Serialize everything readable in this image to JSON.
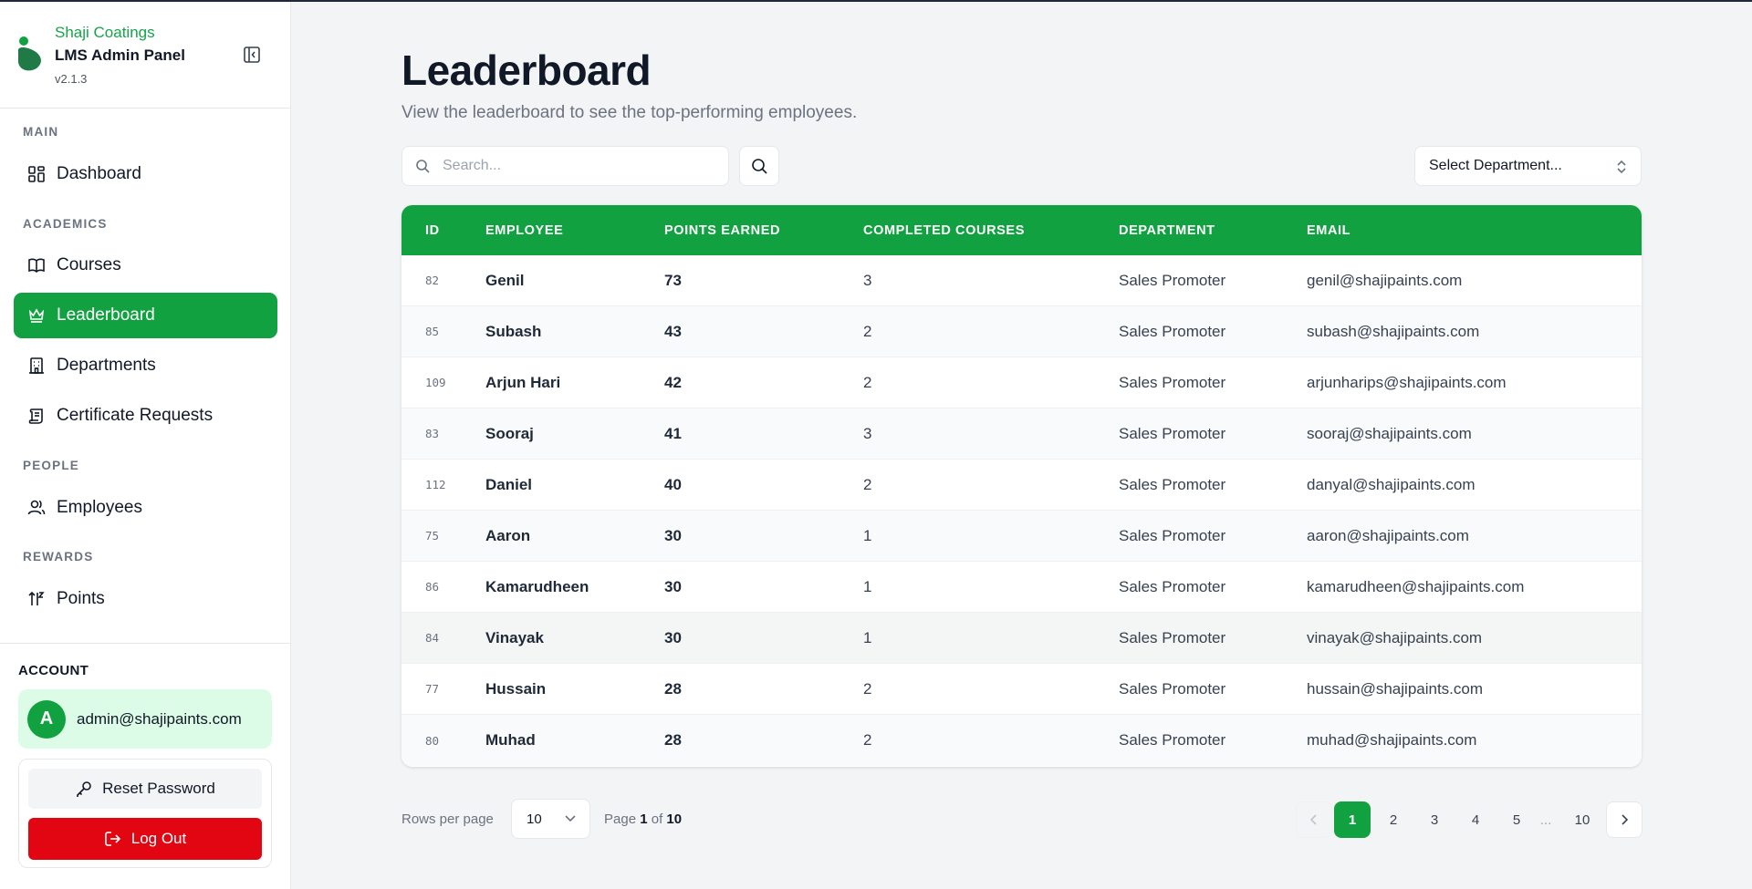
{
  "brand": {
    "company": "Shaji Coatings",
    "app_name": "LMS Admin Panel",
    "version": "v2.1.3"
  },
  "sidebar": {
    "sections": [
      {
        "label": "MAIN",
        "items": [
          {
            "label": "Dashboard",
            "icon": "dashboard-icon"
          }
        ]
      },
      {
        "label": "ACADEMICS",
        "items": [
          {
            "label": "Courses",
            "icon": "book-icon"
          },
          {
            "label": "Leaderboard",
            "icon": "crown-icon",
            "active": true
          },
          {
            "label": "Departments",
            "icon": "building-icon"
          },
          {
            "label": "Certificate Requests",
            "icon": "scroll-icon"
          }
        ]
      },
      {
        "label": "PEOPLE",
        "items": [
          {
            "label": "Employees",
            "icon": "users-icon"
          }
        ]
      },
      {
        "label": "REWARDS",
        "items": [
          {
            "label": "Points",
            "icon": "sort-arrows-icon"
          }
        ]
      }
    ]
  },
  "account": {
    "label": "ACCOUNT",
    "avatar_initial": "A",
    "email": "admin@shajipaints.com",
    "reset_label": "Reset Password",
    "logout_label": "Log Out"
  },
  "page": {
    "title": "Leaderboard",
    "subtitle": "View the leaderboard to see the top-performing employees."
  },
  "filters": {
    "search_placeholder": "Search...",
    "search_value": "",
    "department_select": "Select Department..."
  },
  "table": {
    "columns": [
      "ID",
      "EMPLOYEE",
      "POINTS EARNED",
      "COMPLETED COURSES",
      "DEPARTMENT",
      "EMAIL"
    ],
    "rows": [
      {
        "id": "82",
        "name": "Genil",
        "points": "73",
        "courses": "3",
        "department": "Sales Promoter",
        "email": "genil@shajipaints.com"
      },
      {
        "id": "85",
        "name": "Subash",
        "points": "43",
        "courses": "2",
        "department": "Sales Promoter",
        "email": "subash@shajipaints.com"
      },
      {
        "id": "109",
        "name": "Arjun Hari",
        "points": "42",
        "courses": "2",
        "department": "Sales Promoter",
        "email": "arjunharips@shajipaints.com"
      },
      {
        "id": "83",
        "name": "Sooraj",
        "points": "41",
        "courses": "3",
        "department": "Sales Promoter",
        "email": "sooraj@shajipaints.com"
      },
      {
        "id": "112",
        "name": "Daniel",
        "points": "40",
        "courses": "2",
        "department": "Sales Promoter",
        "email": "danyal@shajipaints.com"
      },
      {
        "id": "75",
        "name": "Aaron",
        "points": "30",
        "courses": "1",
        "department": "Sales Promoter",
        "email": "aaron@shajipaints.com"
      },
      {
        "id": "86",
        "name": "Kamarudheen",
        "points": "30",
        "courses": "1",
        "department": "Sales Promoter",
        "email": "kamarudheen@shajipaints.com"
      },
      {
        "id": "84",
        "name": "Vinayak",
        "points": "30",
        "courses": "1",
        "department": "Sales Promoter",
        "email": "vinayak@shajipaints.com"
      },
      {
        "id": "77",
        "name": "Hussain",
        "points": "28",
        "courses": "2",
        "department": "Sales Promoter",
        "email": "hussain@shajipaints.com"
      },
      {
        "id": "80",
        "name": "Muhad",
        "points": "28",
        "courses": "2",
        "department": "Sales Promoter",
        "email": "muhad@shajipaints.com"
      }
    ]
  },
  "pagination": {
    "rows_per_page_label": "Rows per page",
    "rows_per_page_value": "10",
    "page_prefix": "Page",
    "current_page": "1",
    "of_label": "of",
    "total_pages": "10",
    "pages": [
      "1",
      "2",
      "3",
      "4",
      "5"
    ],
    "ellipsis": "...",
    "last_page": "10"
  },
  "colors": {
    "accent": "#12a140",
    "danger": "#e20613",
    "account_bg": "#dcfce7"
  }
}
